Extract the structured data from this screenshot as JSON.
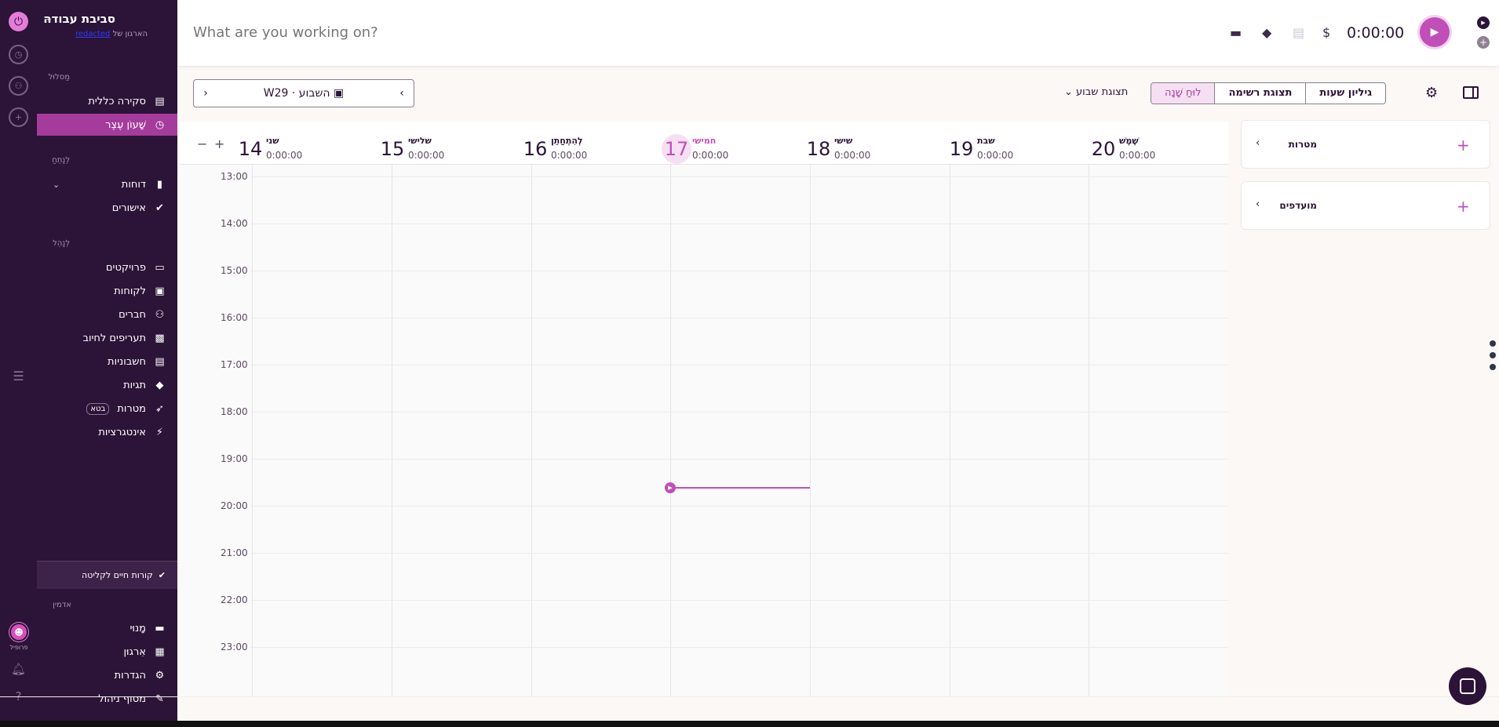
{
  "header": {
    "placeholder": "What are you working on?",
    "timer": "0:00:00",
    "icons": [
      "folder-icon",
      "tag-icon",
      "receipt-icon",
      "dollar-icon"
    ]
  },
  "workspace": {
    "title": "סביבת עבודה",
    "subtitle_prefix": "הארגון של",
    "subtitle_link": "redacted"
  },
  "sidebar": {
    "sections": [
      "מַסלוּל",
      "לְנַתֵחַ",
      "לְנַהֵל"
    ],
    "items": [
      {
        "label": "סקירה כללית",
        "icon": "dashboard-icon"
      },
      {
        "label": "שָׁעוֹן עֶצֶר",
        "icon": "clock-icon"
      },
      {
        "label": "דוחות",
        "icon": "chart-icon"
      },
      {
        "label": "אישורים",
        "icon": "check-circle-icon"
      },
      {
        "label": "פרויקטים",
        "icon": "folder-icon"
      },
      {
        "label": "לקוחות",
        "icon": "contact-icon"
      },
      {
        "label": "חברים",
        "icon": "members-icon"
      },
      {
        "label": "תעריפים לחיוב",
        "icon": "money-icon"
      },
      {
        "label": "חשבוניות",
        "icon": "invoice-icon"
      },
      {
        "label": "תגיות",
        "icon": "tag-icon"
      },
      {
        "label": "מטרות",
        "icon": "rocket-icon",
        "badge": "בטא"
      },
      {
        "label": "אינטגרציות",
        "icon": "plug-icon"
      }
    ],
    "onboarding": "קורות חיים לקליטה",
    "admin_label": "אדמין",
    "admin_items": [
      {
        "label": "מָנוּי",
        "icon": "card-icon"
      },
      {
        "label": "אִרגוּן",
        "icon": "building-icon"
      },
      {
        "label": "הגדרות",
        "icon": "gear-icon"
      },
      {
        "label": "מסוף ניהול",
        "icon": "admin-icon"
      }
    ],
    "profile_label": "פרופיל"
  },
  "toolbar": {
    "week_label": "השבוע",
    "week_code": "W29",
    "view_select": "תצוגת שבוע",
    "tabs": [
      "לוּחַ שָׁנָה",
      "תצוגת רשימה",
      "גיליון שעות"
    ],
    "active_tab": 0
  },
  "calendar": {
    "days": [
      {
        "num": "14",
        "name": "שני",
        "total": "0:00:00"
      },
      {
        "num": "15",
        "name": "שלישי",
        "total": "0:00:00"
      },
      {
        "num": "16",
        "name": "לְהִתְחַתֵן",
        "total": "0:00:00"
      },
      {
        "num": "17",
        "name": "חמישי",
        "total": "0:00:00",
        "today": true
      },
      {
        "num": "18",
        "name": "שישי",
        "total": "0:00:00"
      },
      {
        "num": "19",
        "name": "שבת",
        "total": "0:00:00"
      },
      {
        "num": "20",
        "name": "שֶׁמֶשׁ",
        "total": "0:00:00"
      }
    ],
    "hours": [
      "13:00",
      "14:00",
      "15:00",
      "16:00",
      "17:00",
      "18:00",
      "19:00",
      "20:00",
      "21:00",
      "22:00",
      "23:00"
    ],
    "accent": "#c04fb8"
  },
  "right_panel": {
    "goals": "מטרות",
    "favorites": "מועדפים"
  }
}
